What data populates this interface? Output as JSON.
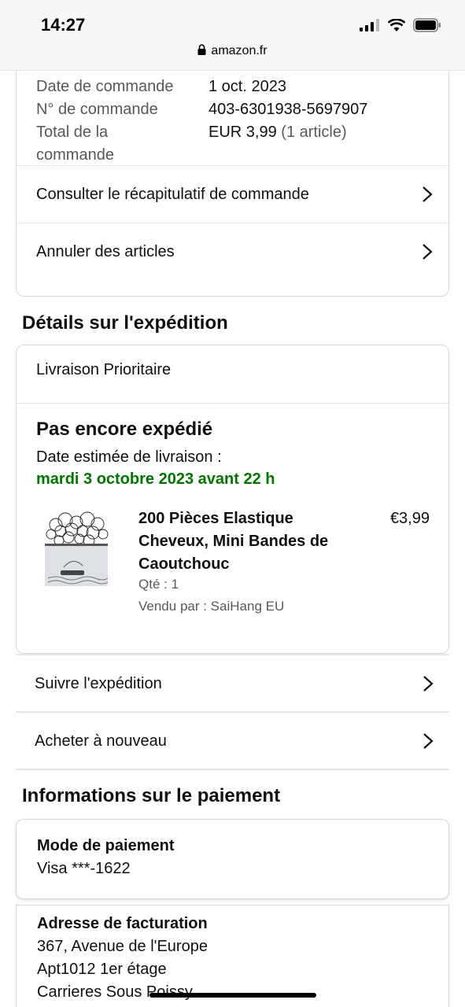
{
  "status_bar": {
    "time": "14:27",
    "url": "amazon.fr"
  },
  "order_summary": {
    "rows": [
      {
        "label": "Date de commande",
        "value": "1 oct. 2023",
        "note": ""
      },
      {
        "label": "N° de commande",
        "value": "403-6301938-5697907",
        "note": ""
      },
      {
        "label": "Total de la commande",
        "value": "EUR 3,99",
        "note": "(1 article)"
      }
    ],
    "link_recap": "Consulter le récapitulatif de commande",
    "link_cancel": "Annuler des articles"
  },
  "shipping": {
    "section_title": "Détails sur l'expédition",
    "method": "Livraison Prioritaire",
    "status": "Pas encore expédié",
    "estimate_label": "Date estimée de livraison :",
    "estimate_date": "mardi 3 octobre 2023 avant 22 h",
    "item": {
      "title": "200 Pièces Elastique Cheveux, Mini Bandes de Caoutchouc",
      "price": "€3,99",
      "qty": "Qté : 1",
      "seller": "Vendu par : SaiHang EU"
    },
    "link_track": "Suivre l'expédition",
    "link_buy_again": "Acheter à nouveau"
  },
  "payment": {
    "section_title": "Informations sur le paiement",
    "method_label": "Mode de paiement",
    "method_value": "Visa ***-1622",
    "billing_label": "Adresse de facturation",
    "billing_lines": [
      "367, Avenue de l'Europe",
      "Apt1012 1er étage",
      "Carrieres Sous Poissy"
    ]
  },
  "colors": {
    "accent_green": "#007600",
    "muted_text": "#565959",
    "border": "#d5d9d9"
  },
  "icons": [
    "lock-icon",
    "signal-icon",
    "wifi-icon",
    "battery-icon",
    "chevron-right-icon"
  ]
}
